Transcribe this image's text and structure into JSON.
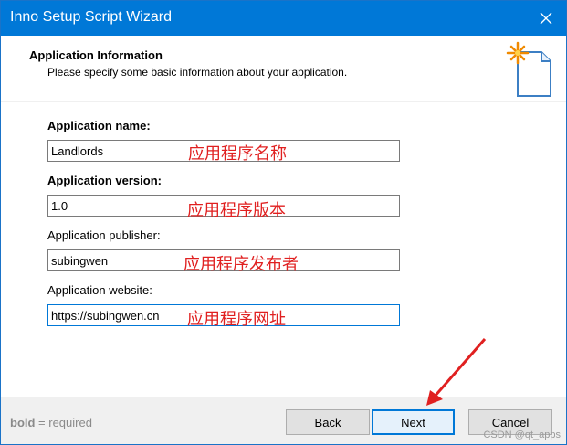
{
  "window": {
    "title": "Inno Setup Script Wizard"
  },
  "header": {
    "title": "Application Information",
    "description": "Please specify some basic information about your application.",
    "icon": "wizard-sparkle-document-icon"
  },
  "form": {
    "fields": [
      {
        "label": "Application name:",
        "value": "Landlords",
        "annotation": "应用程序名称"
      },
      {
        "label": "Application version:",
        "value": "1.0",
        "annotation": "应用程序版本"
      },
      {
        "label": "Application publisher:",
        "value": "subingwen",
        "annotation": "应用程序发布者"
      },
      {
        "label": "Application website:",
        "value": "https://subingwen.cn",
        "annotation": "应用程序网址"
      }
    ]
  },
  "footer": {
    "hint_bold": "bold",
    "hint_rest": " = required",
    "back_label": "Back",
    "next_label": "Next",
    "cancel_label": "Cancel",
    "watermark": "CSDN @qt_apps"
  },
  "colors": {
    "titlebar": "#0078d7",
    "annotation": "#e02020"
  }
}
